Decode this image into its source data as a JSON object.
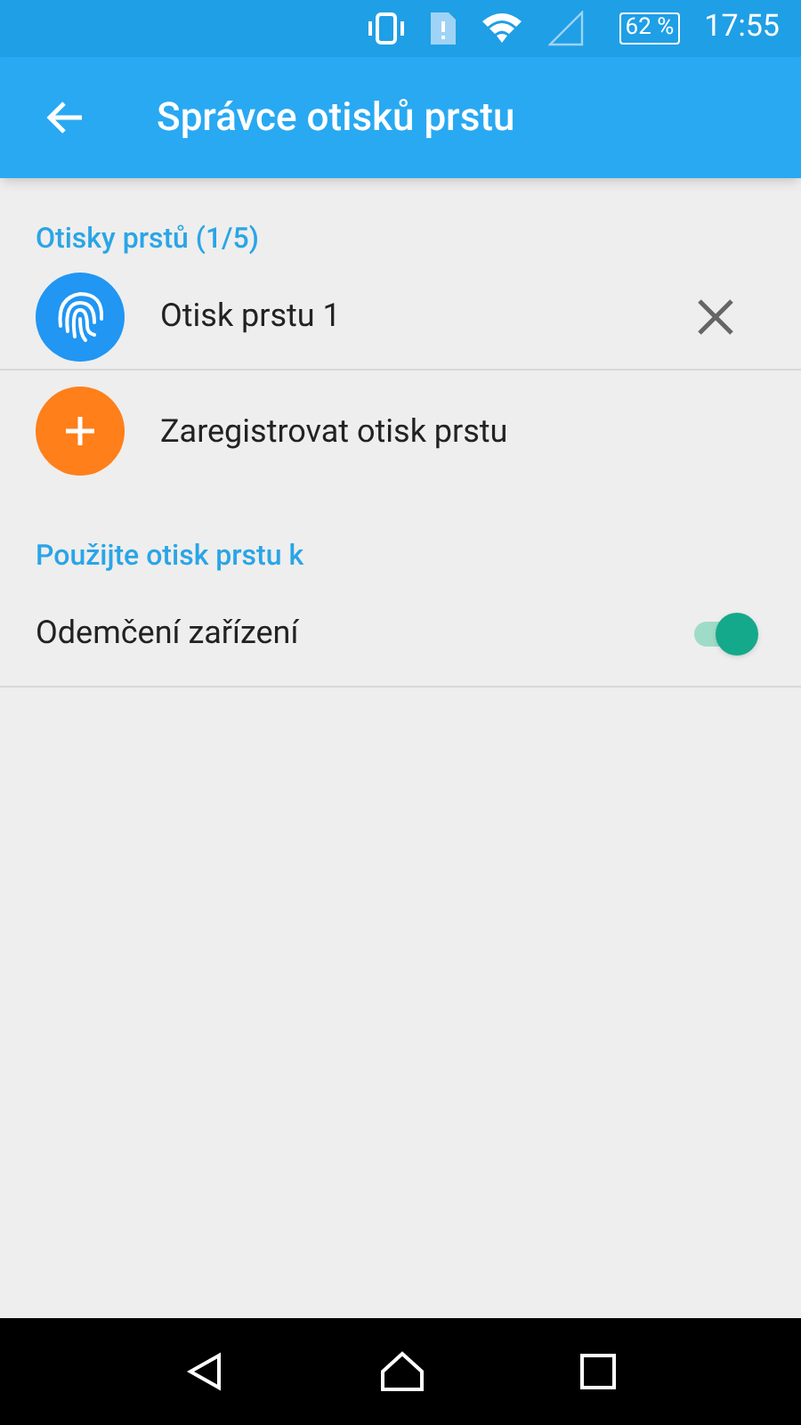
{
  "status_bar": {
    "battery": "62 %",
    "time": "17:55"
  },
  "app_bar": {
    "title": "Správce otisků prstu"
  },
  "fingerprints": {
    "header": "Otisky prstů (1/5)",
    "items": [
      {
        "label": "Otisk prstu 1"
      }
    ],
    "add_label": "Zaregistrovat otisk prstu"
  },
  "use_for": {
    "header": "Použijte otisk prstu k",
    "items": [
      {
        "label": "Odemčení zařízení",
        "on": true
      }
    ]
  }
}
